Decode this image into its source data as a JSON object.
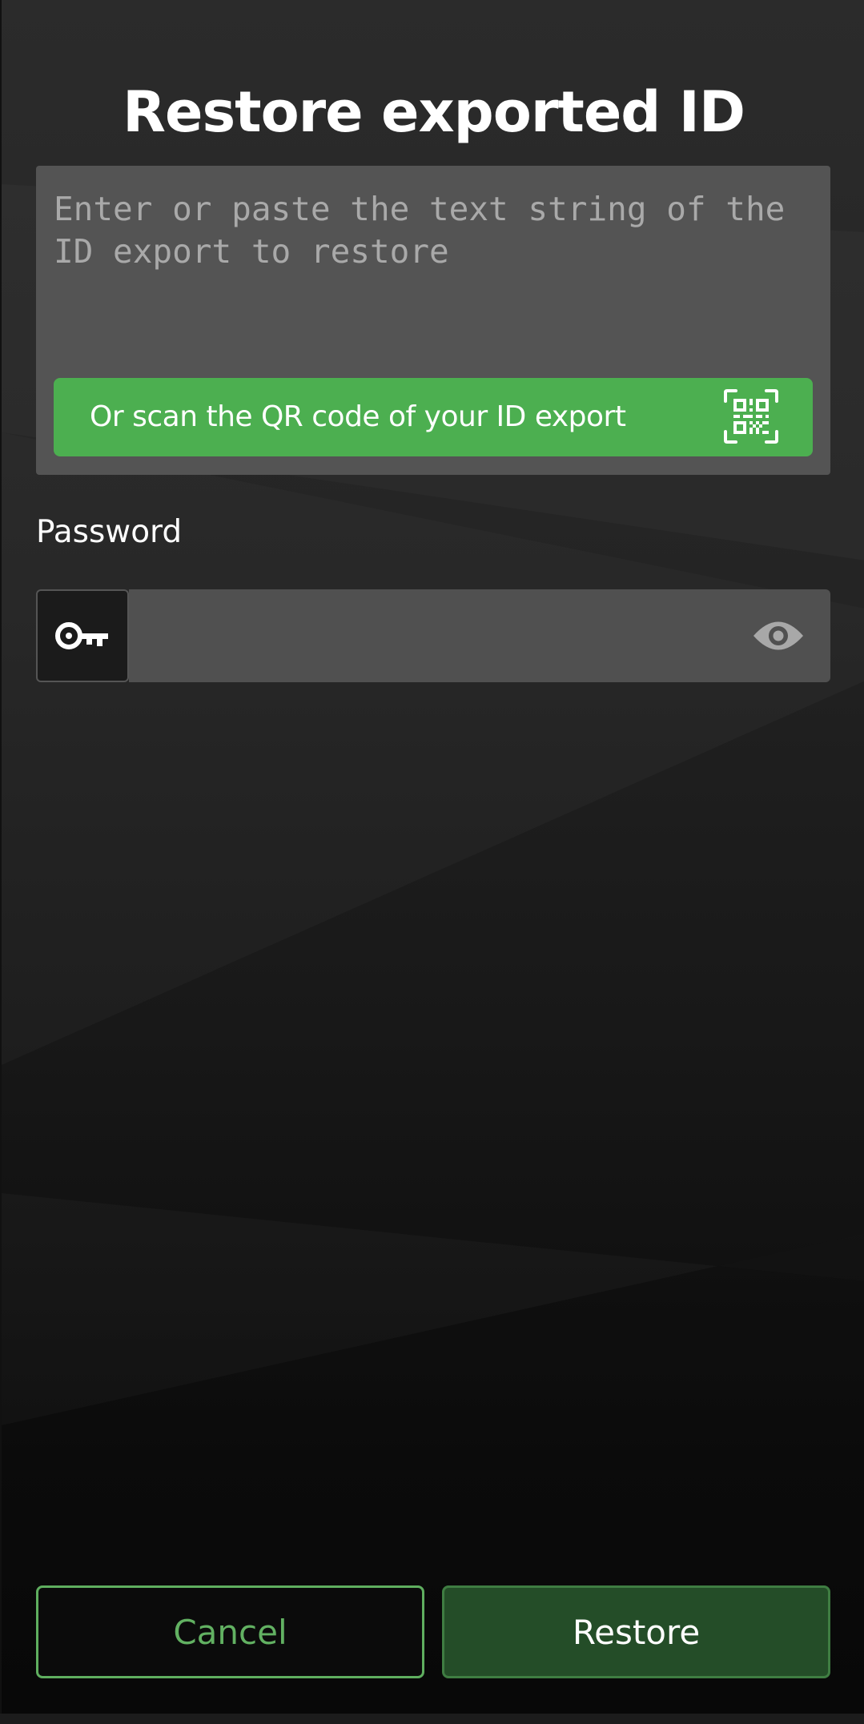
{
  "dialog": {
    "title": "Restore exported ID"
  },
  "export_input": {
    "placeholder": "Enter or paste the text string of the ID export to restore",
    "value": ""
  },
  "qr_scan": {
    "label": "Or scan the QR code of your ID export",
    "icon": "qr-code-scan-icon"
  },
  "password": {
    "label": "Password",
    "value": "",
    "prefix_icon": "key-icon",
    "toggle_icon": "eye-icon"
  },
  "actions": {
    "cancel_label": "Cancel",
    "restore_label": "Restore"
  },
  "colors": {
    "accent_green": "#4caf50",
    "restore_button_bg": "#244d28",
    "cancel_text": "#62b162"
  }
}
